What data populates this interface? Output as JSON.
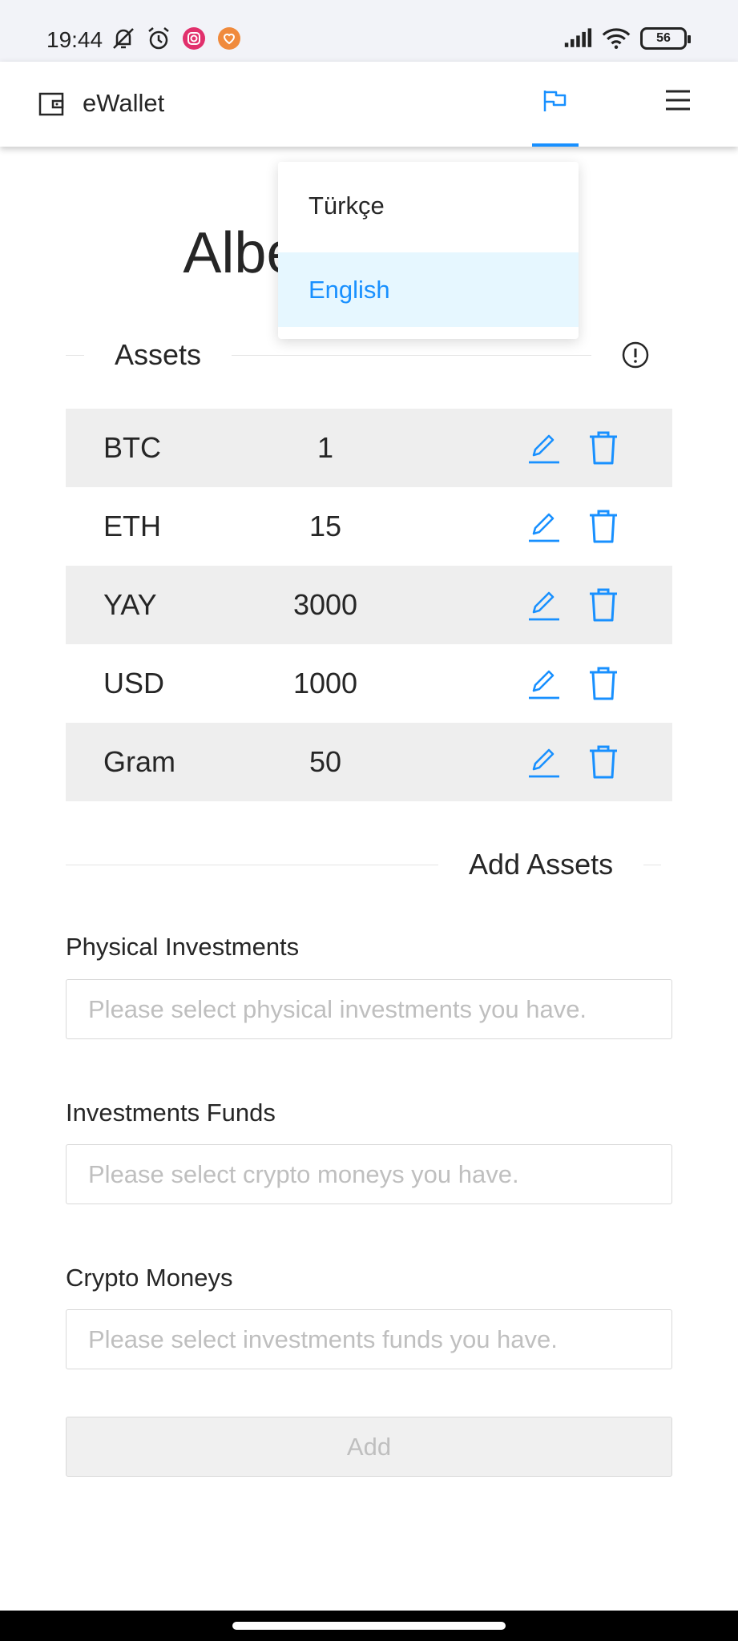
{
  "status_bar": {
    "time": "19:44",
    "battery": "56"
  },
  "header": {
    "app_title": "eWallet"
  },
  "language_menu": {
    "options": [
      "Türkçe",
      "English"
    ],
    "selected": "English"
  },
  "user": {
    "name": "Albert Einstein"
  },
  "assets": {
    "heading": "Assets",
    "rows": [
      {
        "name": "BTC",
        "amount": "1"
      },
      {
        "name": "ETH",
        "amount": "15"
      },
      {
        "name": "YAY",
        "amount": "3000"
      },
      {
        "name": "USD",
        "amount": "1000"
      },
      {
        "name": "Gram",
        "amount": "50"
      }
    ]
  },
  "add_assets": {
    "heading": "Add Assets",
    "fields": [
      {
        "label": "Physical Investments",
        "placeholder": "Please select physical investments you have."
      },
      {
        "label": "Investments Funds",
        "placeholder": "Please select crypto moneys you have."
      },
      {
        "label": "Crypto Moneys",
        "placeholder": "Please select investments funds you have."
      }
    ],
    "add_label": "Add"
  },
  "colors": {
    "accent": "#1890ff",
    "stripe": "#eeeeee",
    "dropdown_selected_bg": "#e6f7ff",
    "placeholder": "#bfbfbf"
  },
  "icons": {
    "wallet": "wallet-icon",
    "language": "flag-icon",
    "menu": "menu-icon",
    "info": "exclamation-circle-icon",
    "edit": "edit-icon",
    "delete": "trash-icon"
  }
}
